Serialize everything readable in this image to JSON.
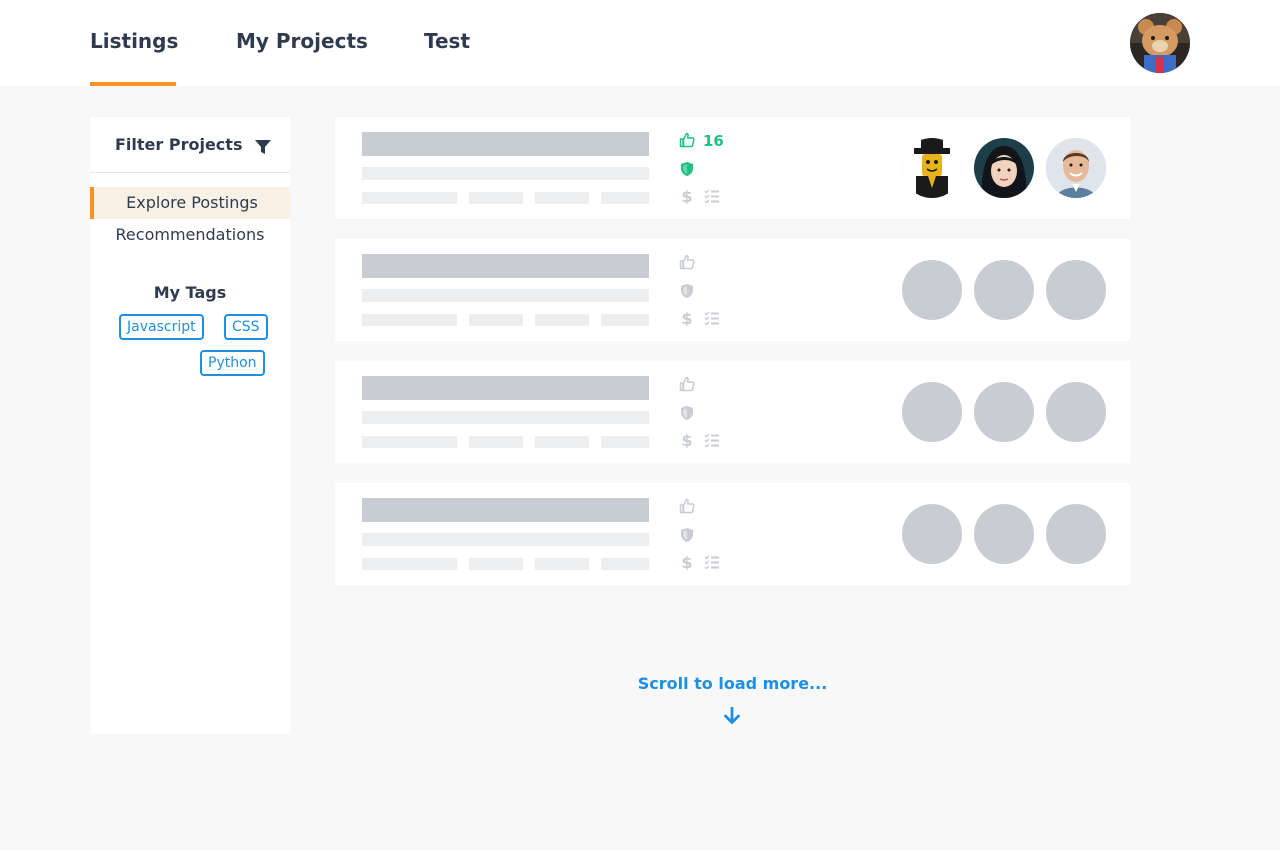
{
  "nav": {
    "tabs": [
      {
        "label": "Listings",
        "active": true
      },
      {
        "label": "My Projects",
        "active": false
      },
      {
        "label": "Test",
        "active": false
      }
    ]
  },
  "sidebar": {
    "filter_title": "Filter Projects",
    "items": [
      {
        "label": "Explore Postings",
        "active": true
      },
      {
        "label": "Recommendations",
        "active": false
      }
    ],
    "tags_title": "My Tags",
    "tags": [
      "Javascript",
      "CSS",
      "Python"
    ]
  },
  "cards": [
    {
      "likes": "16",
      "loaded": true,
      "members": [
        "lego-figure-avatar",
        "woman-avatar",
        "man-avatar"
      ]
    },
    {
      "likes": "",
      "loaded": false
    },
    {
      "likes": "",
      "loaded": false
    },
    {
      "likes": "",
      "loaded": false
    }
  ],
  "load_more": "Scroll to load more...",
  "colors": {
    "accent_orange": "#f7931e",
    "link_blue": "#1e8fe1",
    "green": "#1ec083",
    "skeleton": "#c8ccd3",
    "text_dark": "#2f3b4e"
  }
}
